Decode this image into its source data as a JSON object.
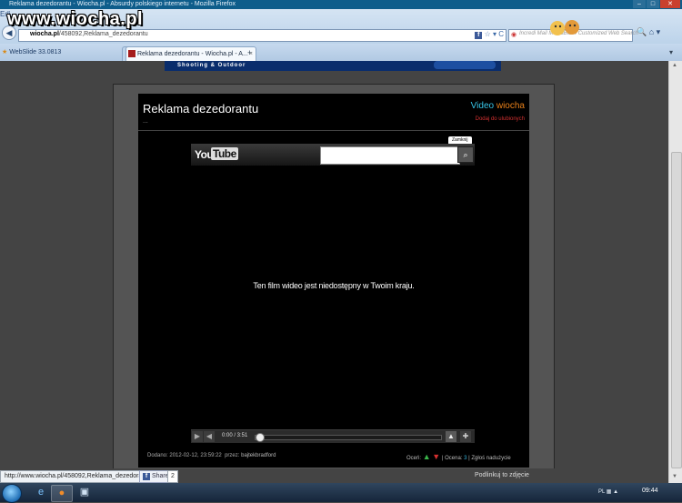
{
  "window": {
    "title": "Reklama dezedorantu - Wiocha.pl - Absurdy polskiego internetu - Mozilla Firefox",
    "min_label": "–",
    "max_label": "□",
    "close_label": "✕"
  },
  "watermark": "www.wiocha.pl",
  "menu_hint": "Edi",
  "nav": {
    "back_label": "◀",
    "url_domain": "wiocha.pl",
    "url_path": "/458092,Reklama_dezedorantu",
    "url_icons": "☆ ▾ C",
    "search_placeholder": "Incredi Mail MediaBar 4 Customized Web Search",
    "extra_icons": "🔍 ⌂ ▾"
  },
  "tabs": {
    "bookmark_label": "WebSlide 33.0813",
    "inactive_tab_label": "x",
    "active_tab_label": "Reklama dezedorantu - Wiocha.pl - A...",
    "active_tab_close": "×",
    "new_tab_label": "+",
    "tab_list_label": "▾"
  },
  "banner": {
    "text": "Shooting & Outdoor"
  },
  "video": {
    "title": "Reklama dezedorantu",
    "title_dots": "...",
    "logo_part1": "Video",
    "logo_part2": "wiocha",
    "favorites_link": "Dodaj do ulubionych",
    "close_label": "Zamknij",
    "yt_you": "You",
    "yt_tube": "Tube",
    "search_value": "",
    "search_icon": "⌕",
    "unavailable_message": "Ten film wideo jest niedostępny w Twoim kraju.",
    "time": "0:00 / 3:51",
    "progress": 0.0
  },
  "meta": {
    "added_prefix": "Dodano:",
    "added_date": "2012-02-12, 23:59:22",
    "by_prefix": "przez:",
    "user": "bajtekbradford",
    "rating_prefix": "Oceń:",
    "score_prefix": "Ocena:",
    "score": "3",
    "report": "Zgłoś nadużycie"
  },
  "status": {
    "url": "http://www.wiocha.pl/458092,Reklama_dezedorantu",
    "share_label": "Share",
    "share_count": "2",
    "share_link": "Podlinkuj to zdjęcie"
  },
  "taskbar": {
    "tray_lang": "PL",
    "tray_icons": "▦ ▲",
    "clock": "09:44"
  }
}
